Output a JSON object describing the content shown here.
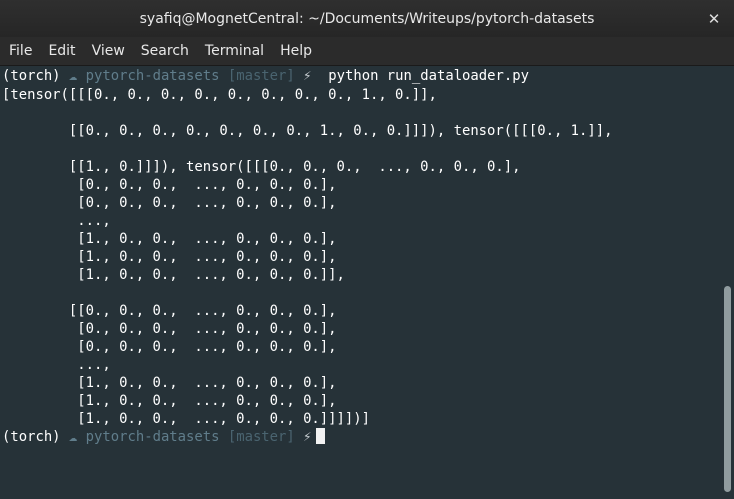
{
  "window": {
    "title": "syafiq@MognetCentral: ~/Documents/Writeups/pytorch-datasets",
    "close_symbol": "✕"
  },
  "menu": [
    "File",
    "Edit",
    "View",
    "Search",
    "Terminal",
    "Help"
  ],
  "terminal": {
    "prompt": {
      "env": "(torch)",
      "cloud": "☁",
      "dir": "pytorch-datasets",
      "branch": "[master]",
      "bolt": "⚡"
    },
    "command": "python run_dataloader.py",
    "output": [
      "[tensor([[[0., 0., 0., 0., 0., 0., 0., 0., 1., 0.]],",
      "",
      "        [[0., 0., 0., 0., 0., 0., 0., 1., 0., 0.]]]), tensor([[[0., 1.]],",
      "",
      "        [[1., 0.]]]), tensor([[[0., 0., 0.,  ..., 0., 0., 0.],",
      "         [0., 0., 0.,  ..., 0., 0., 0.],",
      "         [0., 0., 0.,  ..., 0., 0., 0.],",
      "         ...,",
      "         [1., 0., 0.,  ..., 0., 0., 0.],",
      "         [1., 0., 0.,  ..., 0., 0., 0.],",
      "         [1., 0., 0.,  ..., 0., 0., 0.]],",
      "",
      "        [[0., 0., 0.,  ..., 0., 0., 0.],",
      "         [0., 0., 0.,  ..., 0., 0., 0.],",
      "         [0., 0., 0.,  ..., 0., 0., 0.],",
      "         ...,",
      "         [1., 0., 0.,  ..., 0., 0., 0.],",
      "         [1., 0., 0.,  ..., 0., 0., 0.],",
      "         [1., 0., 0.,  ..., 0., 0., 0.]]]])]"
    ]
  },
  "colors": {
    "terminal_bg": "#263238",
    "prompt_muted": "#607d8b",
    "text": "#ffffff"
  }
}
